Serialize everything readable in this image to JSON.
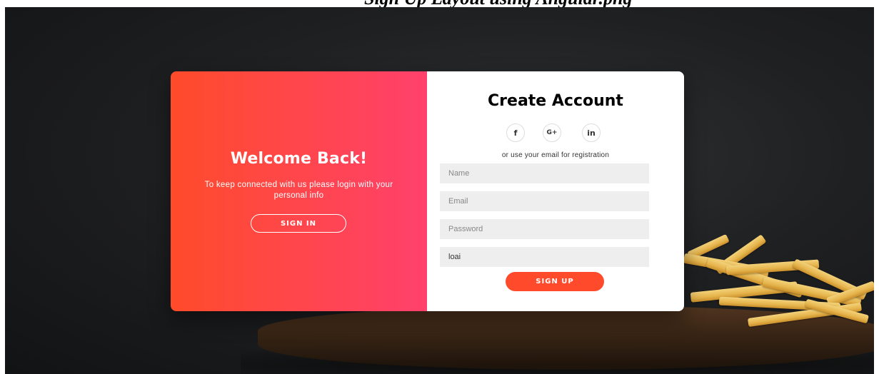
{
  "caption": "Sign Up Layout using Angular.png",
  "overlay": {
    "title": "Welcome Back!",
    "text": "To keep connected with us please login with your personal info",
    "button_label": "SIGN IN"
  },
  "signup": {
    "title": "Create Account",
    "social": [
      {
        "icon": "facebook-icon",
        "label": "f"
      },
      {
        "icon": "google-plus-icon",
        "label": "G+"
      },
      {
        "icon": "linkedin-icon",
        "label": "in"
      }
    ],
    "helper_text": "or use your email for registration",
    "fields": {
      "name_placeholder": "Name",
      "email_placeholder": "Email",
      "password_placeholder": "Password",
      "extra_value": "loai"
    },
    "button_label": "SIGN UP"
  },
  "colors": {
    "gradient_start": "#ff4b2b",
    "gradient_end": "#ff416c",
    "button": "#ff4b2b",
    "input_bg": "#eeeeee"
  }
}
